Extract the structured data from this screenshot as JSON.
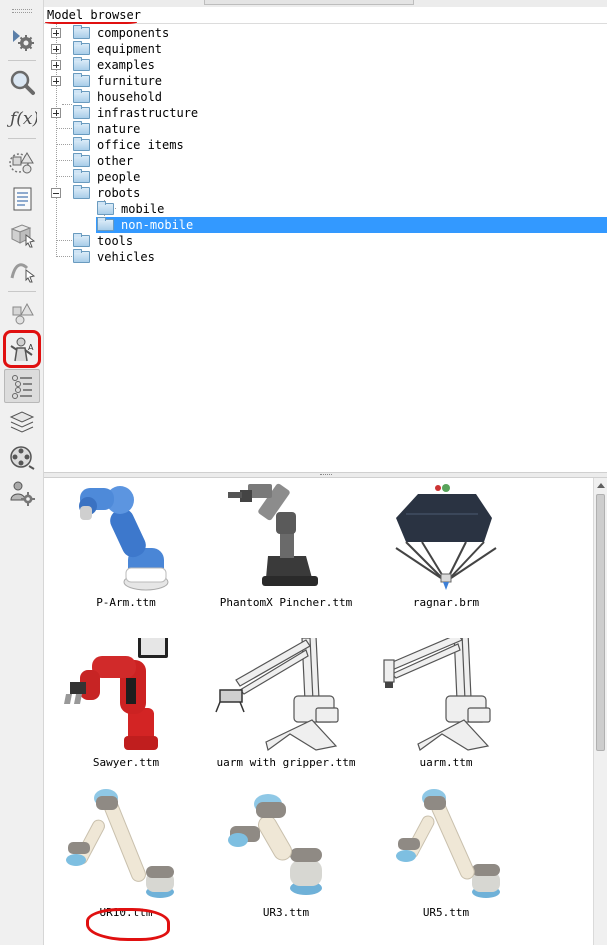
{
  "panel": {
    "title": "Model browser"
  },
  "toolbar": {
    "buttons": [
      {
        "icon": "simulation-settings-icon"
      },
      {
        "icon": "search-magnifier-icon"
      },
      {
        "icon": "function-fx-icon"
      },
      {
        "icon": "shapes-icon"
      },
      {
        "icon": "script-document-icon"
      },
      {
        "icon": "selection-cube-icon"
      },
      {
        "icon": "path-curve-icon"
      },
      {
        "icon": "scene-objects-icon"
      },
      {
        "icon": "model-browser-icon"
      },
      {
        "icon": "hierarchy-list-icon"
      },
      {
        "icon": "layers-icon"
      },
      {
        "icon": "video-recorder-icon"
      },
      {
        "icon": "user-settings-icon"
      }
    ]
  },
  "tree": {
    "items": [
      {
        "label": "components",
        "expandable": true
      },
      {
        "label": "equipment",
        "expandable": true
      },
      {
        "label": "examples",
        "expandable": true
      },
      {
        "label": "furniture",
        "expandable": true
      },
      {
        "label": "household",
        "expandable": false
      },
      {
        "label": "infrastructure",
        "expandable": true
      },
      {
        "label": "nature",
        "expandable": false
      },
      {
        "label": "office items",
        "expandable": false
      },
      {
        "label": "other",
        "expandable": false
      },
      {
        "label": "people",
        "expandable": false
      },
      {
        "label": "robots",
        "expandable": true,
        "expanded": true
      },
      {
        "label": "mobile",
        "child": true
      },
      {
        "label": "non-mobile",
        "child": true,
        "selected": true
      },
      {
        "label": "tools",
        "expandable": false
      },
      {
        "label": "vehicles",
        "expandable": false
      }
    ]
  },
  "models": [
    {
      "name": "P-Arm.ttm"
    },
    {
      "name": "PhantomX Pincher.ttm"
    },
    {
      "name": "ragnar.brm"
    },
    {
      "name": "Sawyer.ttm"
    },
    {
      "name": "uarm with gripper.ttm"
    },
    {
      "name": "uarm.ttm"
    },
    {
      "name": "UR10.ttm"
    },
    {
      "name": "UR3.ttm"
    },
    {
      "name": "UR5.ttm"
    }
  ],
  "colors": {
    "selection": "#3399ff",
    "annotation": "#e01010",
    "folder": "#a9cde9"
  }
}
